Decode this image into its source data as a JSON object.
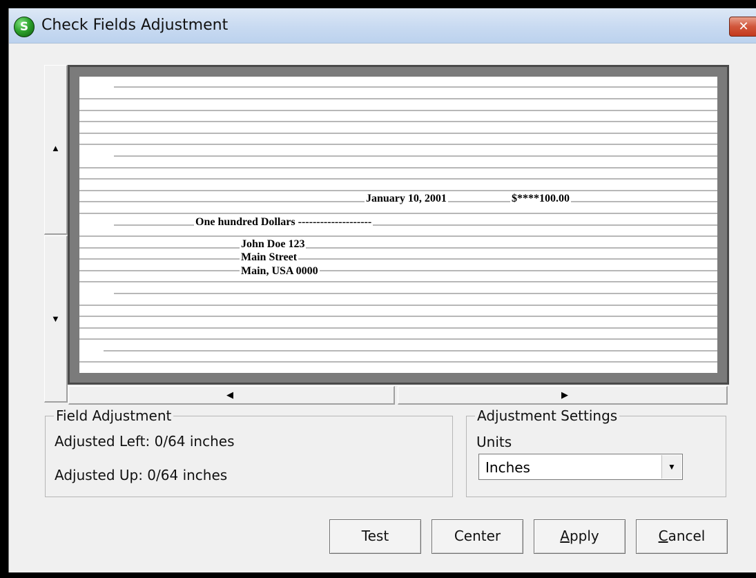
{
  "window": {
    "title": "Check Fields Adjustment",
    "app_icon_letter": "S",
    "close_glyph": "✕"
  },
  "nudge": {
    "up_icon": "▲",
    "down_icon": "▼",
    "left_icon": "◀",
    "right_icon": "▶"
  },
  "check": {
    "date": "January 10, 2001",
    "amount": "$****100.00",
    "amount_words": "One hundred Dollars --------------------",
    "payee_line1": "John Doe 123",
    "payee_line2": "Main Street",
    "payee_line3": "Main, USA 0000"
  },
  "field_adjustment": {
    "legend": "Field Adjustment",
    "adjusted_left": "Adjusted Left: 0/64 inches",
    "adjusted_up": "Adjusted Up: 0/64 inches"
  },
  "adjustment_settings": {
    "legend": "Adjustment Settings",
    "units_label": "Units",
    "units_value": "Inches",
    "dropdown_icon": "▼"
  },
  "buttons": {
    "test": "Test",
    "center": "Center",
    "apply_mnemonic": "A",
    "apply_rest": "pply",
    "cancel_mnemonic": "C",
    "cancel_rest": "ancel"
  }
}
